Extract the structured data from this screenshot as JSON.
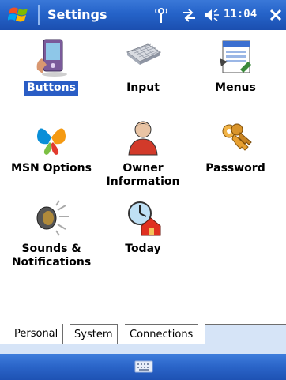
{
  "titlebar": {
    "title": "Settings",
    "clock": "11:04",
    "icons": [
      "windows-start-icon",
      "antenna-icon",
      "sync-icon",
      "volume-icon",
      "close-icon"
    ]
  },
  "items": [
    {
      "label": "Buttons",
      "icon": "buttons-icon",
      "selected": true
    },
    {
      "label": "Input",
      "icon": "keyboard-icon",
      "selected": false
    },
    {
      "label": "Menus",
      "icon": "menus-icon",
      "selected": false
    },
    {
      "label": "MSN Options",
      "icon": "msn-butterfly-icon",
      "selected": false
    },
    {
      "label": "Owner Information",
      "label_line1": "Owner",
      "label_line2": "Information",
      "icon": "owner-icon",
      "selected": false
    },
    {
      "label": "Password",
      "icon": "keys-icon",
      "selected": false
    },
    {
      "label": "Sounds & Notifications",
      "label_line1": "Sounds &",
      "label_line2": "Notifications",
      "icon": "speaker-icon",
      "selected": false
    },
    {
      "label": "Today",
      "icon": "today-icon",
      "selected": false
    }
  ],
  "tabs": [
    {
      "label": "Personal",
      "active": true
    },
    {
      "label": "System",
      "active": false
    },
    {
      "label": "Connections",
      "active": false
    }
  ],
  "menubar": {
    "icon": "keyboard-input-icon"
  }
}
